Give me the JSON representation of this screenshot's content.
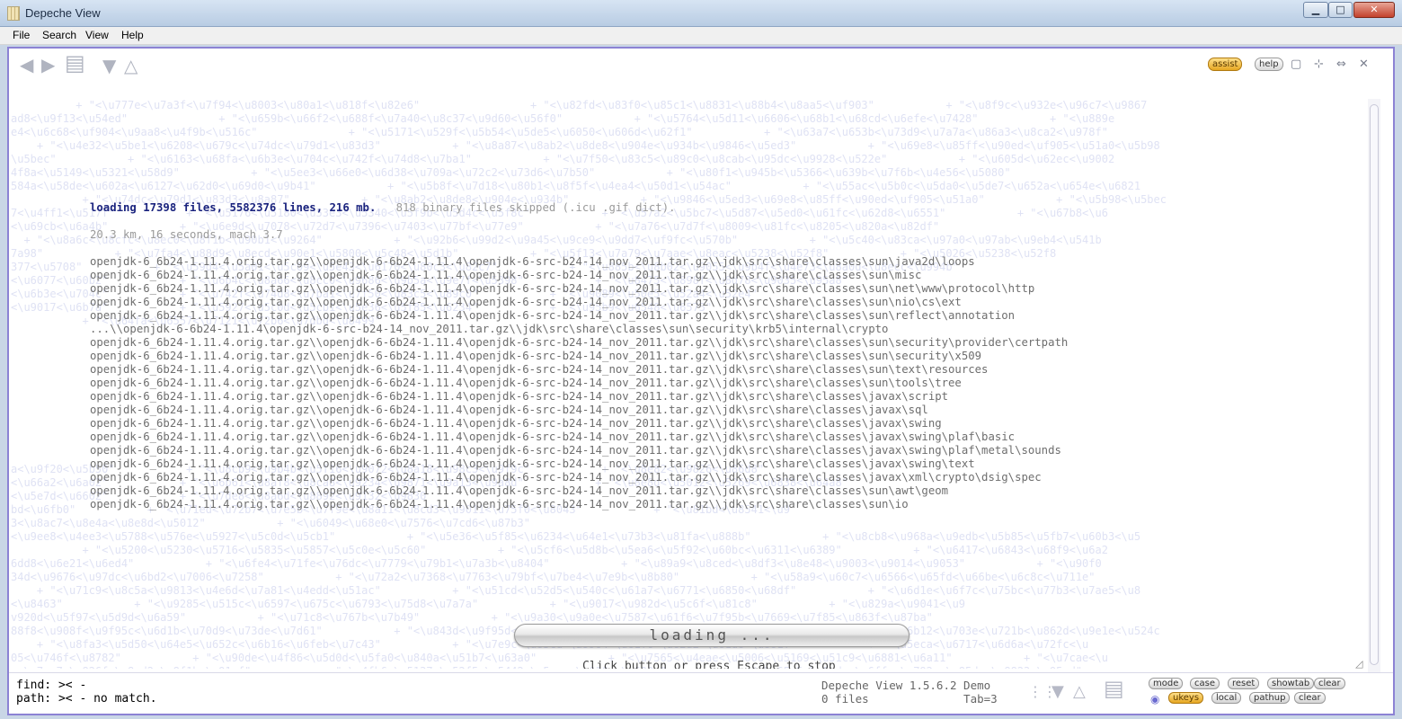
{
  "window": {
    "title": "Depeche View",
    "controls": {
      "minimize": "▁",
      "maximize": "□",
      "close": "✕"
    }
  },
  "menu": [
    "File",
    "Search",
    "View",
    "Help"
  ],
  "toolbar": {
    "assist": "assist",
    "help": "help"
  },
  "content": {
    "loading_summary": "loading 17398 files, 5582376 lines, 216 mb.",
    "binary_skipped": "818 binary files skipped (.icu .gif dict).",
    "stats": "20.3 km, 16 seconds, mach 3.7",
    "paths": [
      "openjdk-6_6b24-1.11.4.orig.tar.gz\\\\openjdk-6-6b24-1.11.4\\openjdk-6-src-b24-14_nov_2011.tar.gz\\\\jdk\\src\\share\\classes\\sun\\java2d\\loops",
      "openjdk-6_6b24-1.11.4.orig.tar.gz\\\\openjdk-6-6b24-1.11.4\\openjdk-6-src-b24-14_nov_2011.tar.gz\\\\jdk\\src\\share\\classes\\sun\\misc",
      "openjdk-6_6b24-1.11.4.orig.tar.gz\\\\openjdk-6-6b24-1.11.4\\openjdk-6-src-b24-14_nov_2011.tar.gz\\\\jdk\\src\\share\\classes\\sun\\net\\www\\protocol\\http",
      "openjdk-6_6b24-1.11.4.orig.tar.gz\\\\openjdk-6-6b24-1.11.4\\openjdk-6-src-b24-14_nov_2011.tar.gz\\\\jdk\\src\\share\\classes\\sun\\nio\\cs\\ext",
      "openjdk-6_6b24-1.11.4.orig.tar.gz\\\\openjdk-6-6b24-1.11.4\\openjdk-6-src-b24-14_nov_2011.tar.gz\\\\jdk\\src\\share\\classes\\sun\\reflect\\annotation",
      "...\\\\openjdk-6-6b24-1.11.4\\openjdk-6-src-b24-14_nov_2011.tar.gz\\\\jdk\\src\\share\\classes\\sun\\security\\krb5\\internal\\crypto",
      "openjdk-6_6b24-1.11.4.orig.tar.gz\\\\openjdk-6-6b24-1.11.4\\openjdk-6-src-b24-14_nov_2011.tar.gz\\\\jdk\\src\\share\\classes\\sun\\security\\provider\\certpath",
      "openjdk-6_6b24-1.11.4.orig.tar.gz\\\\openjdk-6-6b24-1.11.4\\openjdk-6-src-b24-14_nov_2011.tar.gz\\\\jdk\\src\\share\\classes\\sun\\security\\x509",
      "openjdk-6_6b24-1.11.4.orig.tar.gz\\\\openjdk-6-6b24-1.11.4\\openjdk-6-src-b24-14_nov_2011.tar.gz\\\\jdk\\src\\share\\classes\\sun\\text\\resources",
      "openjdk-6_6b24-1.11.4.orig.tar.gz\\\\openjdk-6-6b24-1.11.4\\openjdk-6-src-b24-14_nov_2011.tar.gz\\\\jdk\\src\\share\\classes\\sun\\tools\\tree",
      "openjdk-6_6b24-1.11.4.orig.tar.gz\\\\openjdk-6-6b24-1.11.4\\openjdk-6-src-b24-14_nov_2011.tar.gz\\\\jdk\\src\\share\\classes\\javax\\script",
      "openjdk-6_6b24-1.11.4.orig.tar.gz\\\\openjdk-6-6b24-1.11.4\\openjdk-6-src-b24-14_nov_2011.tar.gz\\\\jdk\\src\\share\\classes\\javax\\sql",
      "openjdk-6_6b24-1.11.4.orig.tar.gz\\\\openjdk-6-6b24-1.11.4\\openjdk-6-src-b24-14_nov_2011.tar.gz\\\\jdk\\src\\share\\classes\\javax\\swing",
      "openjdk-6_6b24-1.11.4.orig.tar.gz\\\\openjdk-6-6b24-1.11.4\\openjdk-6-src-b24-14_nov_2011.tar.gz\\\\jdk\\src\\share\\classes\\javax\\swing\\plaf\\basic",
      "openjdk-6_6b24-1.11.4.orig.tar.gz\\\\openjdk-6-6b24-1.11.4\\openjdk-6-src-b24-14_nov_2011.tar.gz\\\\jdk\\src\\share\\classes\\javax\\swing\\plaf\\metal\\sounds",
      "openjdk-6_6b24-1.11.4.orig.tar.gz\\\\openjdk-6-6b24-1.11.4\\openjdk-6-src-b24-14_nov_2011.tar.gz\\\\jdk\\src\\share\\classes\\javax\\swing\\text",
      "openjdk-6_6b24-1.11.4.orig.tar.gz\\\\openjdk-6-6b24-1.11.4\\openjdk-6-src-b24-14_nov_2011.tar.gz\\\\jdk\\src\\share\\classes\\javax\\xml\\crypto\\dsig\\spec",
      "openjdk-6_6b24-1.11.4.orig.tar.gz\\\\openjdk-6-6b24-1.11.4\\openjdk-6-src-b24-14_nov_2011.tar.gz\\\\jdk\\src\\share\\classes\\sun\\awt\\geom",
      "openjdk-6_6b24-1.11.4.orig.tar.gz\\\\openjdk-6-6b24-1.11.4\\openjdk-6-src-b24-14_nov_2011.tar.gz\\\\jdk\\src\\share\\classes\\sun\\io"
    ],
    "background_lines": [
      "          + \"<\\u777e<\\u7a3f<\\u7f94<\\u8003<\\u80a1<\\u818f<\\u82e6\"                 + \"<\\u82fd<\\u83f0<\\u85c1<\\u8831<\\u88b4<\\u8aa5<\\uf903\"           + \"<\\u8f9c<\\u932e<\\u96c7<\\u9867",
      "ad8<\\u9f13<\\u54ed\"              + \"<\\u659b<\\u66f2<\\u688f<\\u7a40<\\u8c37<\\u9d60<\\u56f0\"           + \"<\\u5764<\\u5d11<\\u6606<\\u68b1<\\u68cd<\\u6efe<\\u7428\"           + \"<\\u889e",
      "e4<\\u6c68<\\uf904<\\u9aa8<\\u4f9b<\\u516c\"              + \"<\\u5171<\\u529f<\\u5b54<\\u5de5<\\u6050<\\u606d<\\u62f1\"           + \"<\\u63a7<\\u653b<\\u73d9<\\u7a7a<\\u86a3<\\u8ca2<\\u978f\"",
      "    + \"<\\u4e32<\\u5be1<\\u6208<\\u679c<\\u74dc<\\u79d1<\\u83d3\"           + \"<\\u8a87<\\u8ab2<\\u8de8<\\u904e<\\u934b<\\u9846<\\u5ed3\"           + \"<\\u69e8<\\u85ff<\\u90ed<\\uf905<\\u51a0<\\u5b98",
      "\\u5bec\"           + \"<\\u6163<\\u68fa<\\u6b3e<\\u704c<\\u742f<\\u74d8<\\u7ba1\"           + \"<\\u7f50<\\u83c5<\\u89c0<\\u8cab<\\u95dc<\\u9928<\\u522e\"           + \"<\\u605d<\\u62ec<\\u9002",
      "4f8a<\\u5149<\\u5321<\\u58d9\"           + \"<\\u5ee3<\\u66e0<\\u6d38<\\u709a<\\u72c2<\\u73d6<\\u7b50\"           + \"<\\u80f1<\\u945b<\\u5366<\\u639b<\\u7f6b<\\u4e56<\\u5080\"",
      "584a<\\u58de<\\u602a<\\u6127<\\u62d0<\\u69d0<\\u9b41\"           + \"<\\u5b8f<\\u7d18<\\u80b1<\\u8f5f<\\u4ea4<\\u50d1<\\u54ac\"           + \"<\\u55ac<\\u5b0c<\\u5da0<\\u5de7<\\u652a<\\u654e<\\u6821",
      "           + \"<\\u74dc<\\u79d1<\\u83d3<\\u8a87\"           + \"<\\u8ab2<\\u8de8<\\u904e<\\u934b\"           + \"<\\u9846<\\u5ed3<\\u69e8<\\u85ff<\\u90ed<\\uf905<\\u51a0\"           + \"<\\u5b98<\\u5bec",
      "7<\\u4ff1<\\u517f\"           + \"<\\u5176<\\u5180<\\u53e3<\\u5340<\\u5f9b<\\u5d4c<\\u5f8c\"           + \"<\\u57a2<\\u5bc7<\\u5d87<\\u5ed0<\\u61fc<\\u62d8<\\u6551\"           + \"<\\u67b8<\\u6",
      "<\\u69cb<\\u6a4b\"           + \"<\\u6e9d<\\u7078<\\u72d7<\\u7396<\\u7403<\\u77bf<\\u77e9\"           + \"<\\u7a76<\\u7d7f<\\u8009<\\u81fc<\\u8205<\\u820a<\\u82df\"",
      "  + \"<\\u8a6c<\\u8cfc<\\u8ec0<\\u8f1b<\\u90b1<\\u9264\"           + \"<\\u92b6<\\u99d2<\\u9a45<\\u9ce9<\\u9dd7<\\uf9fc<\\u570b\"           + \"<\\u5c40<\\u83ca<\\u97a0<\\u97ab<\\u9eb4<\\u541b",
      "7a98\"           + \"<\\u7fa4<\\u88d9<\\u8ecd<\\u90e1<\\u5800<\\u5c48<\\u5d1b\"           + \"<\\u5f13<\\u7a79<\\u7aae<\\u8eac<\\u5238<\\u52f8\"           + \"<\\u5026<\\u5238<\\u52f8",
      "377<\\u5708\"           + \"<\\u59d4<\\u5a01<\\u5c09<\\u5e43<\\u6170<\\u80c3<\\u82c7\"           + \"<\\u885b<\\u8b02<\\u9055<\\u9b4f<\\u4e73<\\u8a0d<\\u8ecc<\\u994b\"",
      "<\\u6077<\\u60b2\"           + \"<\\u6b4c<\\u8a66<\\u8cc0<\\u9686<\\u9b5a<\\u9e7f<\\u5398\"           + \"<\\u8475<\\u898f<\\u8d78<\\u9035<\\u95a8\"",
      "<\\u6b3e<\\u704c\"           + \"<\\u742f<\\u74d8<\\u7ba1<\\u7f50<\\u83c5<\\u89c0\"           + \"<\\u9089<\\u50e5<\\u52a4<\\u52e4\"",
      "<\\u9017<\\u6b7a\"           + \"<\\u5927<\\u5c0d<\\u5cb1<\\u5e36<\\u5f85<\\u6234\"           + \"<\\u95b9<\\u6548<\\u6575\"",
      "           + \"<\\u64fa<\\u6557<\\u7121<\\u72b6<\\u7dbd<\\u8499\"",
      "",
      "",
      "",
      "",
      "",
      "",
      "",
      "",
      "",
      "",
      "a<\\u9f20<\\u5b50\"           + \"<\\u8cb9<\\u9b4b<\\u5f16<\\u9072<\\u8a18<\\u98c3<\\u9f9c\"           + \"<\\u8e82<\\u9826<\\u86d8\"",
      "<\\u66a2<\\u6a02\"           + \"<\\u6b61<\\u8af8<\\u8ca8<\\u9234<\\u9871<\\u9a13<\\u9a8d\"           + \"<\\u8e8d<\\u5012<\\u5269<\\u6838<\\u64a8\"",
      "<\\u5e7d<\\u6602\"           + \"<\\u7de8<\\u8a6d<\\u8892<\\u9132<\\u9830",
      "bd<\\u6fb0\"           + \"<\\u71ed<\\u72b7<\\u7e5b<\\u7f9e<\\u8a11<\\u8cd3<\\u9011<\\u75f0<\\u8043\"           + \"<\\u81bd<\\u8541<\\u9",
      "3<\\u8ac7<\\u8e4a<\\u8e8d<\\u5012\"           + \"<\\u6049<\\u68e0<\\u7576<\\u7cd6<\\u87b3\"",
      "<\\u9ee8<\\u4ee3<\\u5788<\\u576e<\\u5927<\\u5c0d<\\u5cb1\"           + \"<\\u5e36<\\u5f85<\\u6234<\\u64e1<\\u73b3<\\u81fa<\\u888b\"           + \"<\\u8cb8<\\u968a<\\u9edb<\\u5b85<\\u5fb7<\\u60b3<\\u5",
      "           + \"<\\u5200<\\u5230<\\u5716<\\u5835<\\u5857<\\u5c0e<\\u5c60\"           + \"<\\u5cf6<\\u5d8b<\\u5ea6<\\u5f92<\\u60bc<\\u6311<\\u6389\"           + \"<\\u6417<\\u6843<\\u68f9<\\u6a2",
      "6dd8<\\u6e21<\\u6ed4\"           + \"<\\u6fe4<\\u71fe<\\u76dc<\\u7779<\\u79b1<\\u7a3b<\\u8404\"           + \"<\\u89a9<\\u8ced<\\u8df3<\\u8e48<\\u9003<\\u9014<\\u9053\"           + \"<\\u90f0",
      "34d<\\u9676<\\u97dc<\\u6bd2<\\u7006<\\u7258\"           + \"<\\u72a2<\\u7368<\\u7763<\\u79bf<\\u7be4<\\u7e9b<\\u8b80\"           + \"<\\u58a9<\\u60c7<\\u6566<\\u65fd<\\u66be<\\u6c8c<\\u711e\"",
      "    + \"<\\u71c9<\\u8c5a<\\u9813<\\u4e6d<\\u7a81<\\u4edd<\\u51ac\"           + \"<\\u51cd<\\u52d5<\\u540c<\\u61a7<\\u6771<\\u6850<\\u68df\"           + \"<\\u6d1e<\\u6f7c<\\u75bc<\\u77b3<\\u7ae5<\\u8",
      "<\\u8463\"           + \"<\\u9285<\\u515c<\\u6597<\\u675c<\\u6793<\\u75d8<\\u7a7a\"           + \"<\\u9017<\\u982d<\\u5c6f<\\u81c8\"           + \"<\\u829a<\\u9041<\\u9",
      "v920d<\\u5f97<\\u5d9d<\\u6a59\"           + \"<\\u71c8<\\u767b<\\u7b49\"           + \"<\\u9a30<\\u9a0e<\\u7587<\\u61f6<\\u7f95b<\\u7669<\\u7f85<\\u863f<\\u87ba\"",
      "88f8<\\u908f<\\u9f95c<\\u6d1b<\\u70d9<\\u73de<\\u7d61\"           + \"<\\u843d<\\u9f95d<\\u916a<\\u99f1<\\u9f95e<\\u4e82<\\u5375\"           + \"<\\u6b04<\\u6b12<\\u703e<\\u721b<\\u862d<\\u9e1e<\\u524c",
      "    + \"<\\u8fa3<\\u5d50<\\u64e5<\\u652c<\\u6b16<\\u6feb<\\u7c43\"           + \"<\\u7e9c<\\u85cd<\\u8964<\\u61f6<\\u62d2<\\u81d8<\\u881f\"           + \"<\\u5eca<\\u6717<\\u6d6a<\\u72fc<\\u",
      "05<\\u746f<\\u8782\"           + \"<\\u90de<\\u4f86<\\u5d0d<\\u5fa0<\\u840a<\\u51b7<\\u63a0\"           + \"<\\u7565<\\u4eae<\\u5006<\\u5169<\\u51c9<\\u6881<\\u6a11\"           + \"<\\u7cae<\\u",
      "x<\\u7ce7<\\u826f<\\u8ad2<\\u8f1b<\\u91cf\"           + \"<\\u4fb6<\\u5137<\\u52f5<\\u5442<\\u5eec<\\u616e<\\u623e\"           + \"<\\u65c5<\\u6ada<\\u6ffe<\\u792a<\\u85dc<\\u8823<\\u95ad\""
    ],
    "loading_label": "loading ...",
    "escape_hint": "Click button or press Escape to stop"
  },
  "bottom": {
    "find_line": "find: >< -",
    "path_line": "path: >< - no match.",
    "version": "Depeche View 1.5.6.2 Demo",
    "files": "0 files",
    "tab": "Tab=3",
    "buttons_row1": [
      "mode",
      "case",
      "reset",
      "showtab",
      "clear"
    ],
    "buttons_row2": [
      "ukeys",
      "local",
      "pathup",
      "clear"
    ]
  }
}
